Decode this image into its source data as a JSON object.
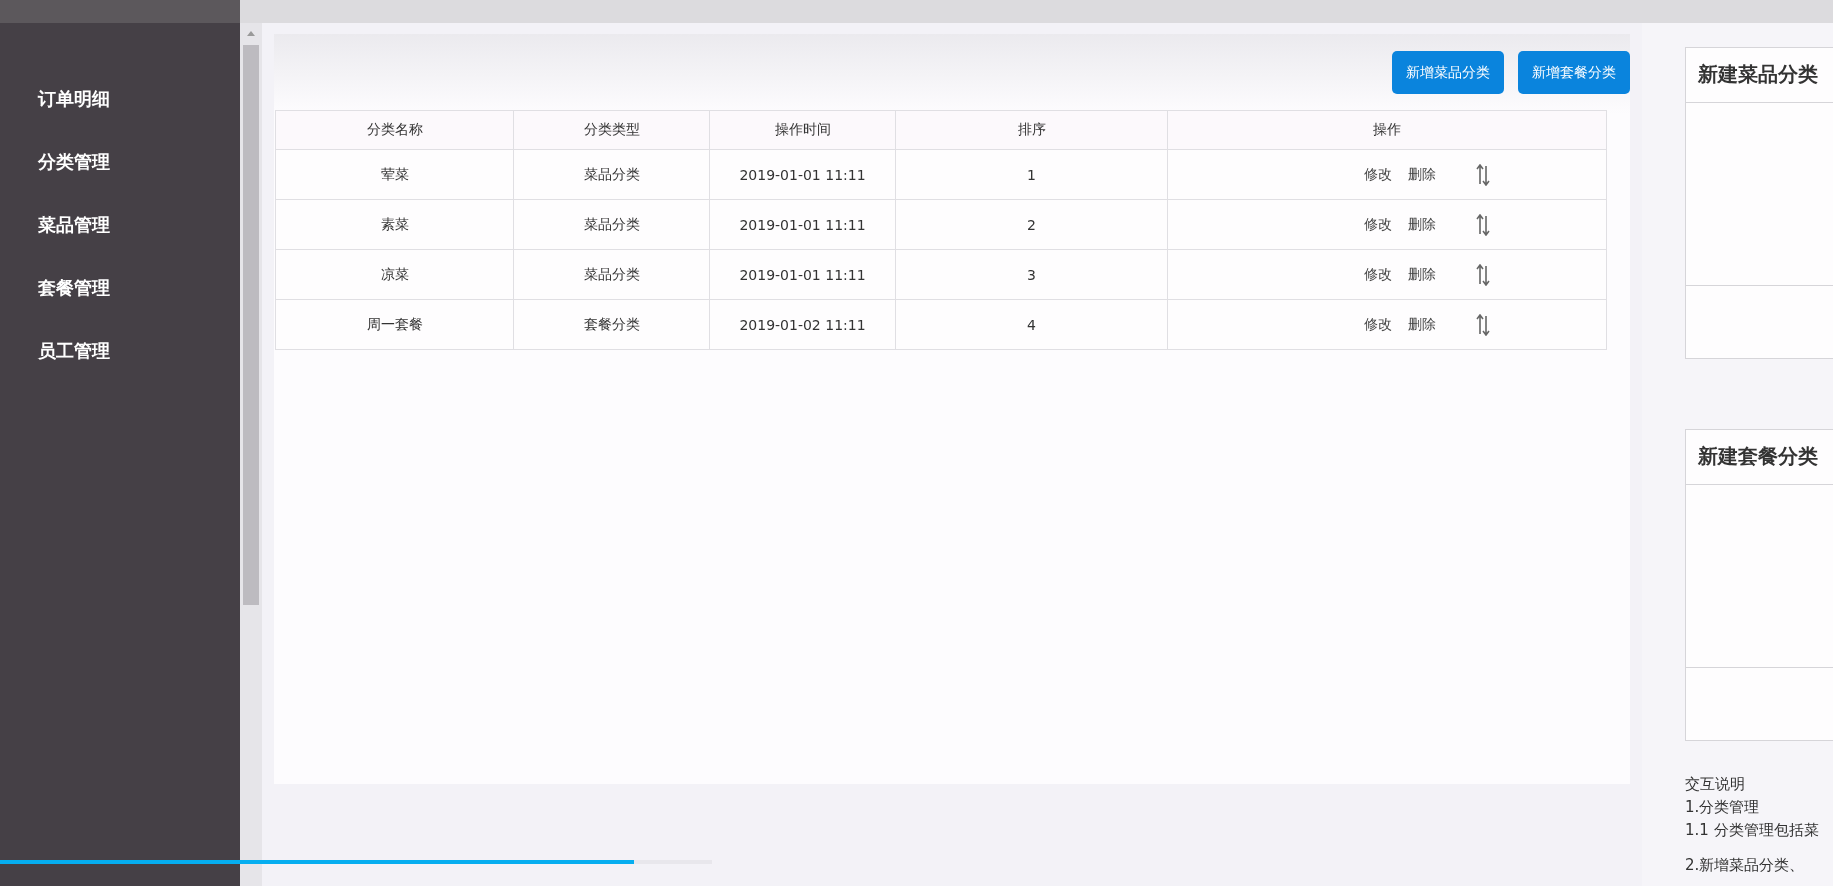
{
  "sidebar": {
    "items": [
      {
        "label": "订单明细",
        "selected": false
      },
      {
        "label": "分类管理",
        "selected": false
      },
      {
        "label": "菜品管理",
        "selected": false
      },
      {
        "label": "套餐管理",
        "selected": false
      },
      {
        "label": "员工管理",
        "selected": false
      }
    ]
  },
  "toolbar": {
    "buttons": [
      "新增菜品分类",
      "新增套餐分类"
    ]
  },
  "table": {
    "columns": [
      "分类名称",
      "分类类型",
      "操作时间",
      "排序",
      "操作"
    ],
    "rows": [
      {
        "cells": [
          "荤菜",
          "菜品分类",
          "2019-01-01 11:11",
          "1"
        ],
        "actions": [
          "修改",
          "删除"
        ]
      },
      {
        "cells": [
          "素菜",
          "菜品分类",
          "2019-01-01 11:11",
          "2"
        ],
        "actions": [
          "修改",
          "删除"
        ]
      },
      {
        "cells": [
          "凉菜",
          "菜品分类",
          "2019-01-01 11:11",
          "3"
        ],
        "actions": [
          "修改",
          "删除"
        ]
      },
      {
        "cells": [
          "周一套餐",
          "套餐分类",
          "2019-01-02 11:11",
          "4"
        ],
        "actions": [
          "修改",
          "删除"
        ]
      }
    ]
  },
  "dialogs": [
    {
      "title": "新建菜品分类"
    },
    {
      "title": "新建套餐分类"
    }
  ],
  "notes": [
    "交互说明",
    "1.分类管理",
    "1.1 分类管理包括菜",
    "2.新增菜品分类、"
  ],
  "video_progress": {
    "level": 0.89
  }
}
